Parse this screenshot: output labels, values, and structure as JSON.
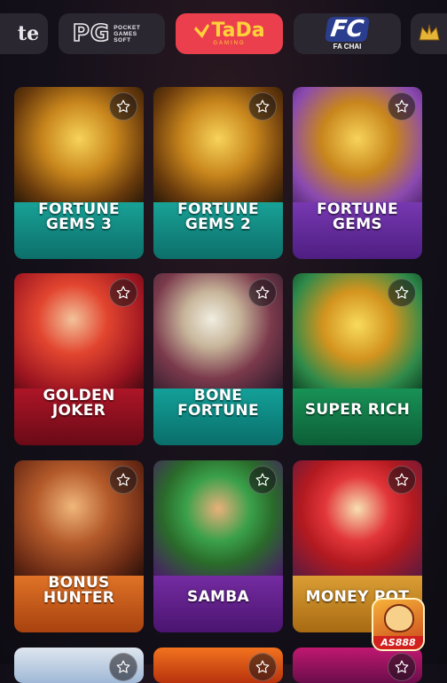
{
  "providers": [
    {
      "name": "partial-provider-logo",
      "text": "te"
    },
    {
      "name": "pg-soft-logo",
      "text": "PG",
      "sub": "POCKET GAMES SOFT"
    },
    {
      "name": "tada-gaming-logo",
      "text": "TaDa",
      "sub": "GAMING"
    },
    {
      "name": "fa-chai-logo",
      "text": "FC",
      "sub": "FA CHAI"
    },
    {
      "name": "partial-provider-logo-2",
      "text": ""
    }
  ],
  "games": [
    {
      "title": "FORTUNE\nGEMS 3",
      "theme": "teal-gold"
    },
    {
      "title": "FORTUNE\nGEMS 2",
      "theme": "teal-gold"
    },
    {
      "title": "FORTUNE\nGEMS",
      "theme": "purple-gold"
    },
    {
      "title": "GOLDEN\nJOKER",
      "theme": "red"
    },
    {
      "title": "BONE\nFORTUNE",
      "theme": "teal"
    },
    {
      "title": "SUPER RICH",
      "theme": "green"
    },
    {
      "title": "BONUS\nHUNTER",
      "theme": "orange"
    },
    {
      "title": "SAMBA",
      "theme": "purple"
    },
    {
      "title": "MONEY POT",
      "theme": "gold"
    }
  ],
  "favorite_icon": "star-outline-icon",
  "badge": {
    "text": "AS888"
  }
}
